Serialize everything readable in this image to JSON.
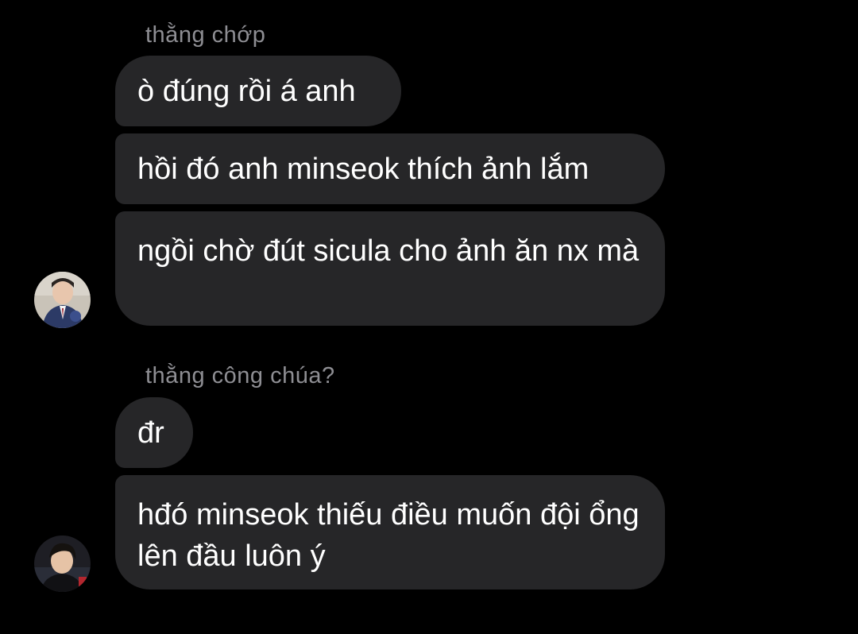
{
  "threads": [
    {
      "sender": "thằng chớp",
      "messages": [
        "ò đúng rồi á anh",
        "hồi đó anh minseok thích ảnh lắm",
        "ngồi chờ đút sicula cho ảnh ăn nx mà"
      ]
    },
    {
      "sender": "thằng công chúa?",
      "messages": [
        "đr",
        "hđó minseok thiếu điều muốn đội ổng lên đầu luôn ý"
      ]
    }
  ],
  "colors": {
    "background": "#000000",
    "bubble": "#262628",
    "sender_name": "#8e8e93",
    "text": "#ffffff"
  },
  "icons": [
    "avatar-photo",
    "avatar-photo"
  ]
}
